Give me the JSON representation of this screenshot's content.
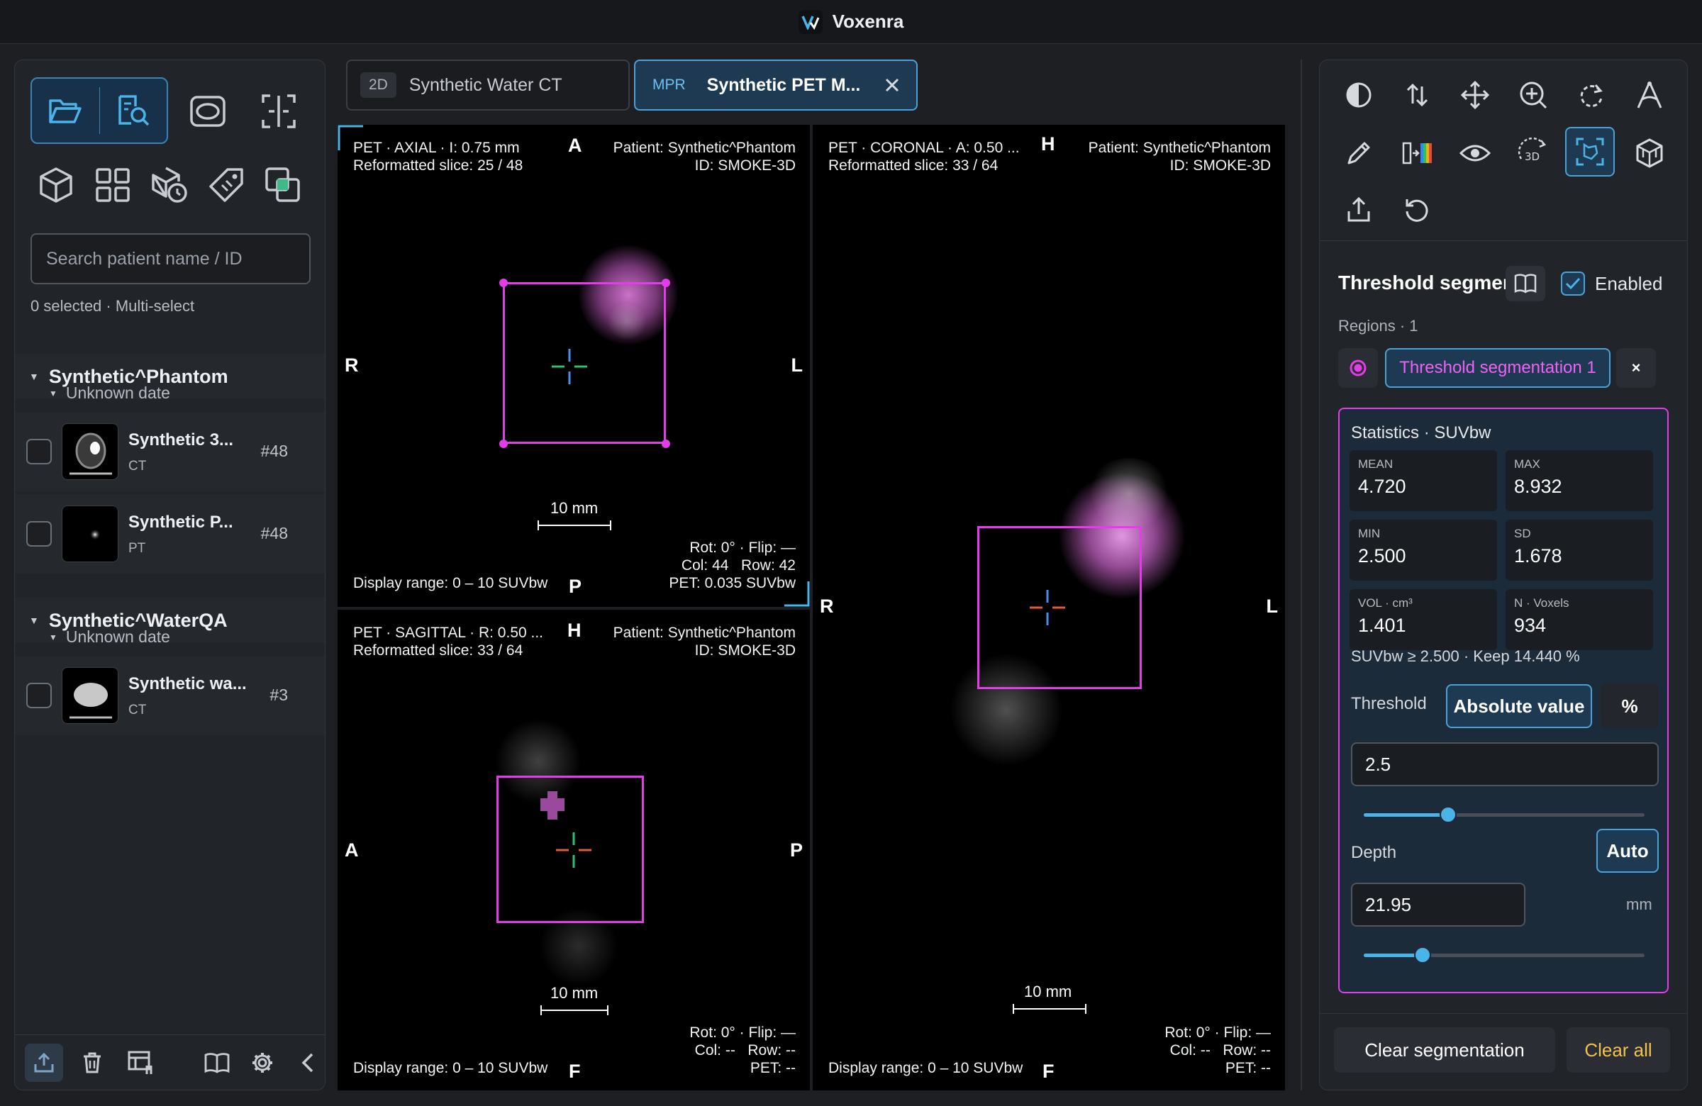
{
  "app": {
    "title": "Voxenra"
  },
  "left_panel": {
    "search_placeholder": "Search patient name / ID",
    "selection_status": "0 selected · Multi-select",
    "patients": [
      {
        "name": "Synthetic^Phantom",
        "date": "Unknown date",
        "series": [
          {
            "name": "Synthetic 3...",
            "modality": "CT",
            "count": "#48"
          },
          {
            "name": "Synthetic P...",
            "modality": "PT",
            "count": "#48"
          }
        ]
      },
      {
        "name": "Synthetic^WaterQA",
        "date": "Unknown date",
        "series": [
          {
            "name": "Synthetic wa...",
            "modality": "CT",
            "count": "#3"
          }
        ]
      }
    ]
  },
  "tabs": [
    {
      "badge": "2D",
      "title": "Synthetic Water CT"
    },
    {
      "badge": "MPR",
      "title": "Synthetic PET M..."
    }
  ],
  "viewports": {
    "axial": {
      "header_left": "PET · AXIAL · I: 0.75 mm\nReformatted slice: 25 / 48",
      "header_right": "Patient: Synthetic^Phantom\nID: SMOKE-3D",
      "top": "A",
      "bottom": "P",
      "left": "R",
      "right": "L",
      "scale": "10 mm",
      "footer_right": "Rot: 0° · Flip: —\nCol: 44   Row: 42\nPET: 0.035 SUVbw",
      "display_range": "Display range: 0 – 10 SUVbw"
    },
    "coronal": {
      "header_left": "PET · CORONAL · A: 0.50 ...\nReformatted slice: 33 / 64",
      "header_right": "Patient: Synthetic^Phantom\nID: SMOKE-3D",
      "top": "H",
      "bottom": "F",
      "left": "R",
      "right": "L",
      "scale": "10 mm",
      "footer_right": "Rot: 0° · Flip: —\nCol: --   Row: --\nPET: --",
      "display_range": "Display range: 0 – 10 SUVbw"
    },
    "sagittal": {
      "header_left": "PET · SAGITTAL · R: 0.50 ...\nReformatted slice: 33 / 64",
      "header_right": "Patient: Synthetic^Phantom\nID: SMOKE-3D",
      "top": "H",
      "bottom": "F",
      "left": "A",
      "right": "P",
      "scale": "10 mm",
      "footer_right": "Rot: 0° · Flip: —\nCol: --   Row: --\nPET: --",
      "display_range": "Display range: 0 – 10 SUVbw"
    }
  },
  "right_panel": {
    "tools": [
      "contrast-icon",
      "flip-icon",
      "pan-icon",
      "zoom-icon",
      "rotate-icon",
      "measure-angle-icon",
      "pencil-icon",
      "colormap-icon",
      "eye-icon",
      "3d-rotate-icon",
      "roi-select-icon",
      "cube-icon",
      "export-icon",
      "reset-icon"
    ],
    "section_title": "Threshold segmentation",
    "enabled_label": "Enabled",
    "regions_label": "Regions · 1",
    "region_name": "Threshold segmentation 1",
    "region_delete": "×",
    "stats_title": "Statistics · SUVbw",
    "stats": [
      {
        "label": "MEAN",
        "value": "4.720"
      },
      {
        "label": "MAX",
        "value": "8.932"
      },
      {
        "label": "MIN",
        "value": "2.500"
      },
      {
        "label": "SD",
        "value": "1.678"
      },
      {
        "label": "VOL · cm³",
        "value": "1.401"
      },
      {
        "label": "N · Voxels",
        "value": "934"
      }
    ],
    "threshold_summary": "SUVbw ≥ 2.500 · Keep 14.440 %",
    "threshold_label": "Threshold",
    "threshold_mode_abs": "Absolute value",
    "threshold_mode_pct": "%",
    "threshold_value": "2.5",
    "threshold_slider_fraction": 0.3,
    "depth_label": "Depth",
    "depth_auto": "Auto",
    "depth_value": "21.95",
    "depth_unit": "mm",
    "depth_slider_fraction": 0.21,
    "clear_segmentation": "Clear segmentation",
    "clear_all": "Clear all",
    "colors": {
      "accent": "#4aa3d8",
      "roi": "#e23de8",
      "warning": "#f2c14e"
    }
  }
}
